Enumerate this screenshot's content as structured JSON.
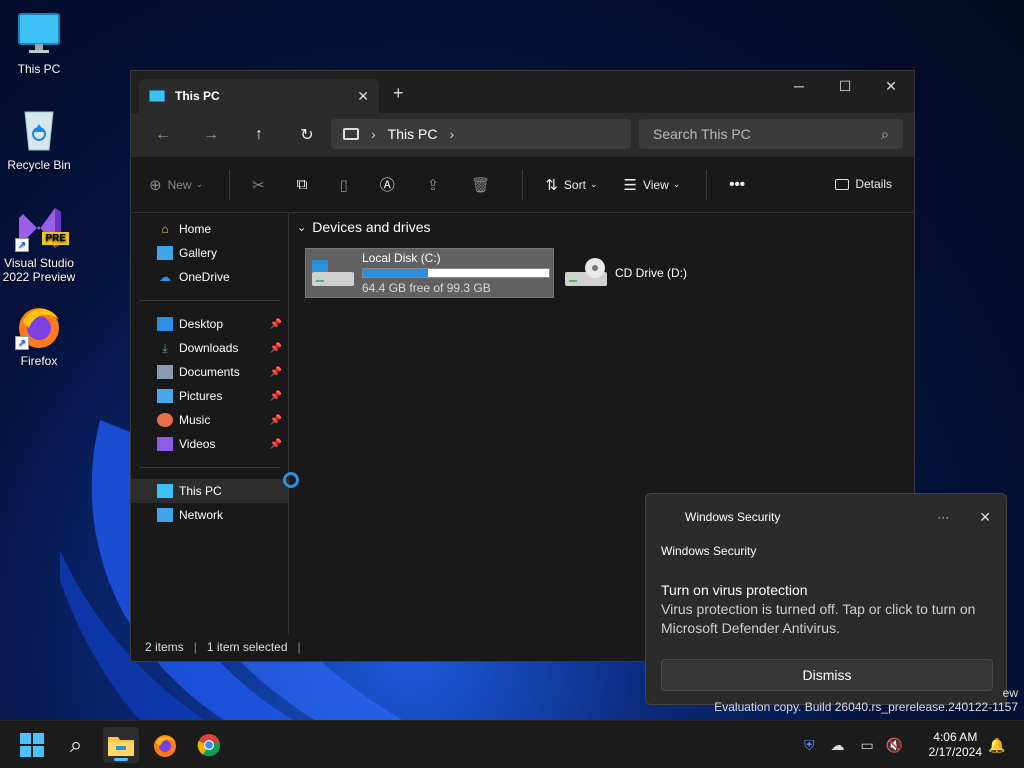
{
  "desktop": {
    "icons": [
      {
        "label": "This PC"
      },
      {
        "label": "Recycle Bin"
      },
      {
        "label": "Visual Studio 2022 Preview",
        "badge": "PRE"
      },
      {
        "label": "Firefox"
      }
    ]
  },
  "explorer": {
    "tab_title": "This PC",
    "address": "This PC",
    "search_placeholder": "Search This PC",
    "toolbar": {
      "new_label": "New",
      "sort_label": "Sort",
      "view_label": "View",
      "details_label": "Details"
    },
    "sidebar": {
      "top": [
        {
          "label": "Home"
        },
        {
          "label": "Gallery"
        },
        {
          "label": "OneDrive"
        }
      ],
      "pinned": [
        {
          "label": "Desktop"
        },
        {
          "label": "Downloads"
        },
        {
          "label": "Documents"
        },
        {
          "label": "Pictures"
        },
        {
          "label": "Music"
        },
        {
          "label": "Videos"
        }
      ],
      "bottom": [
        {
          "label": "This PC"
        },
        {
          "label": "Network"
        }
      ]
    },
    "group_label": "Devices and drives",
    "drives": [
      {
        "name": "Local Disk (C:)",
        "free_text": "64.4 GB free of 99.3 GB",
        "used_fraction": 0.35
      },
      {
        "name": "CD Drive (D:)"
      }
    ],
    "status": {
      "items": "2 items",
      "selected": "1 item selected"
    }
  },
  "toast": {
    "header": "Windows Security",
    "app": "Windows Security",
    "title": "Turn on virus protection",
    "message": "Virus protection is turned off. Tap or click to turn on Microsoft Defender Antivirus.",
    "dismiss_label": "Dismiss"
  },
  "watermark": {
    "line1": "ew",
    "line2": "Evaluation copy. Build 26040.rs_prerelease.240122-1157"
  },
  "taskbar": {
    "time": "4:06 AM",
    "date": "2/17/2024"
  },
  "colors": {
    "accent": "#2b8fdc",
    "taskbar_indicator": "#4cc2ff"
  }
}
